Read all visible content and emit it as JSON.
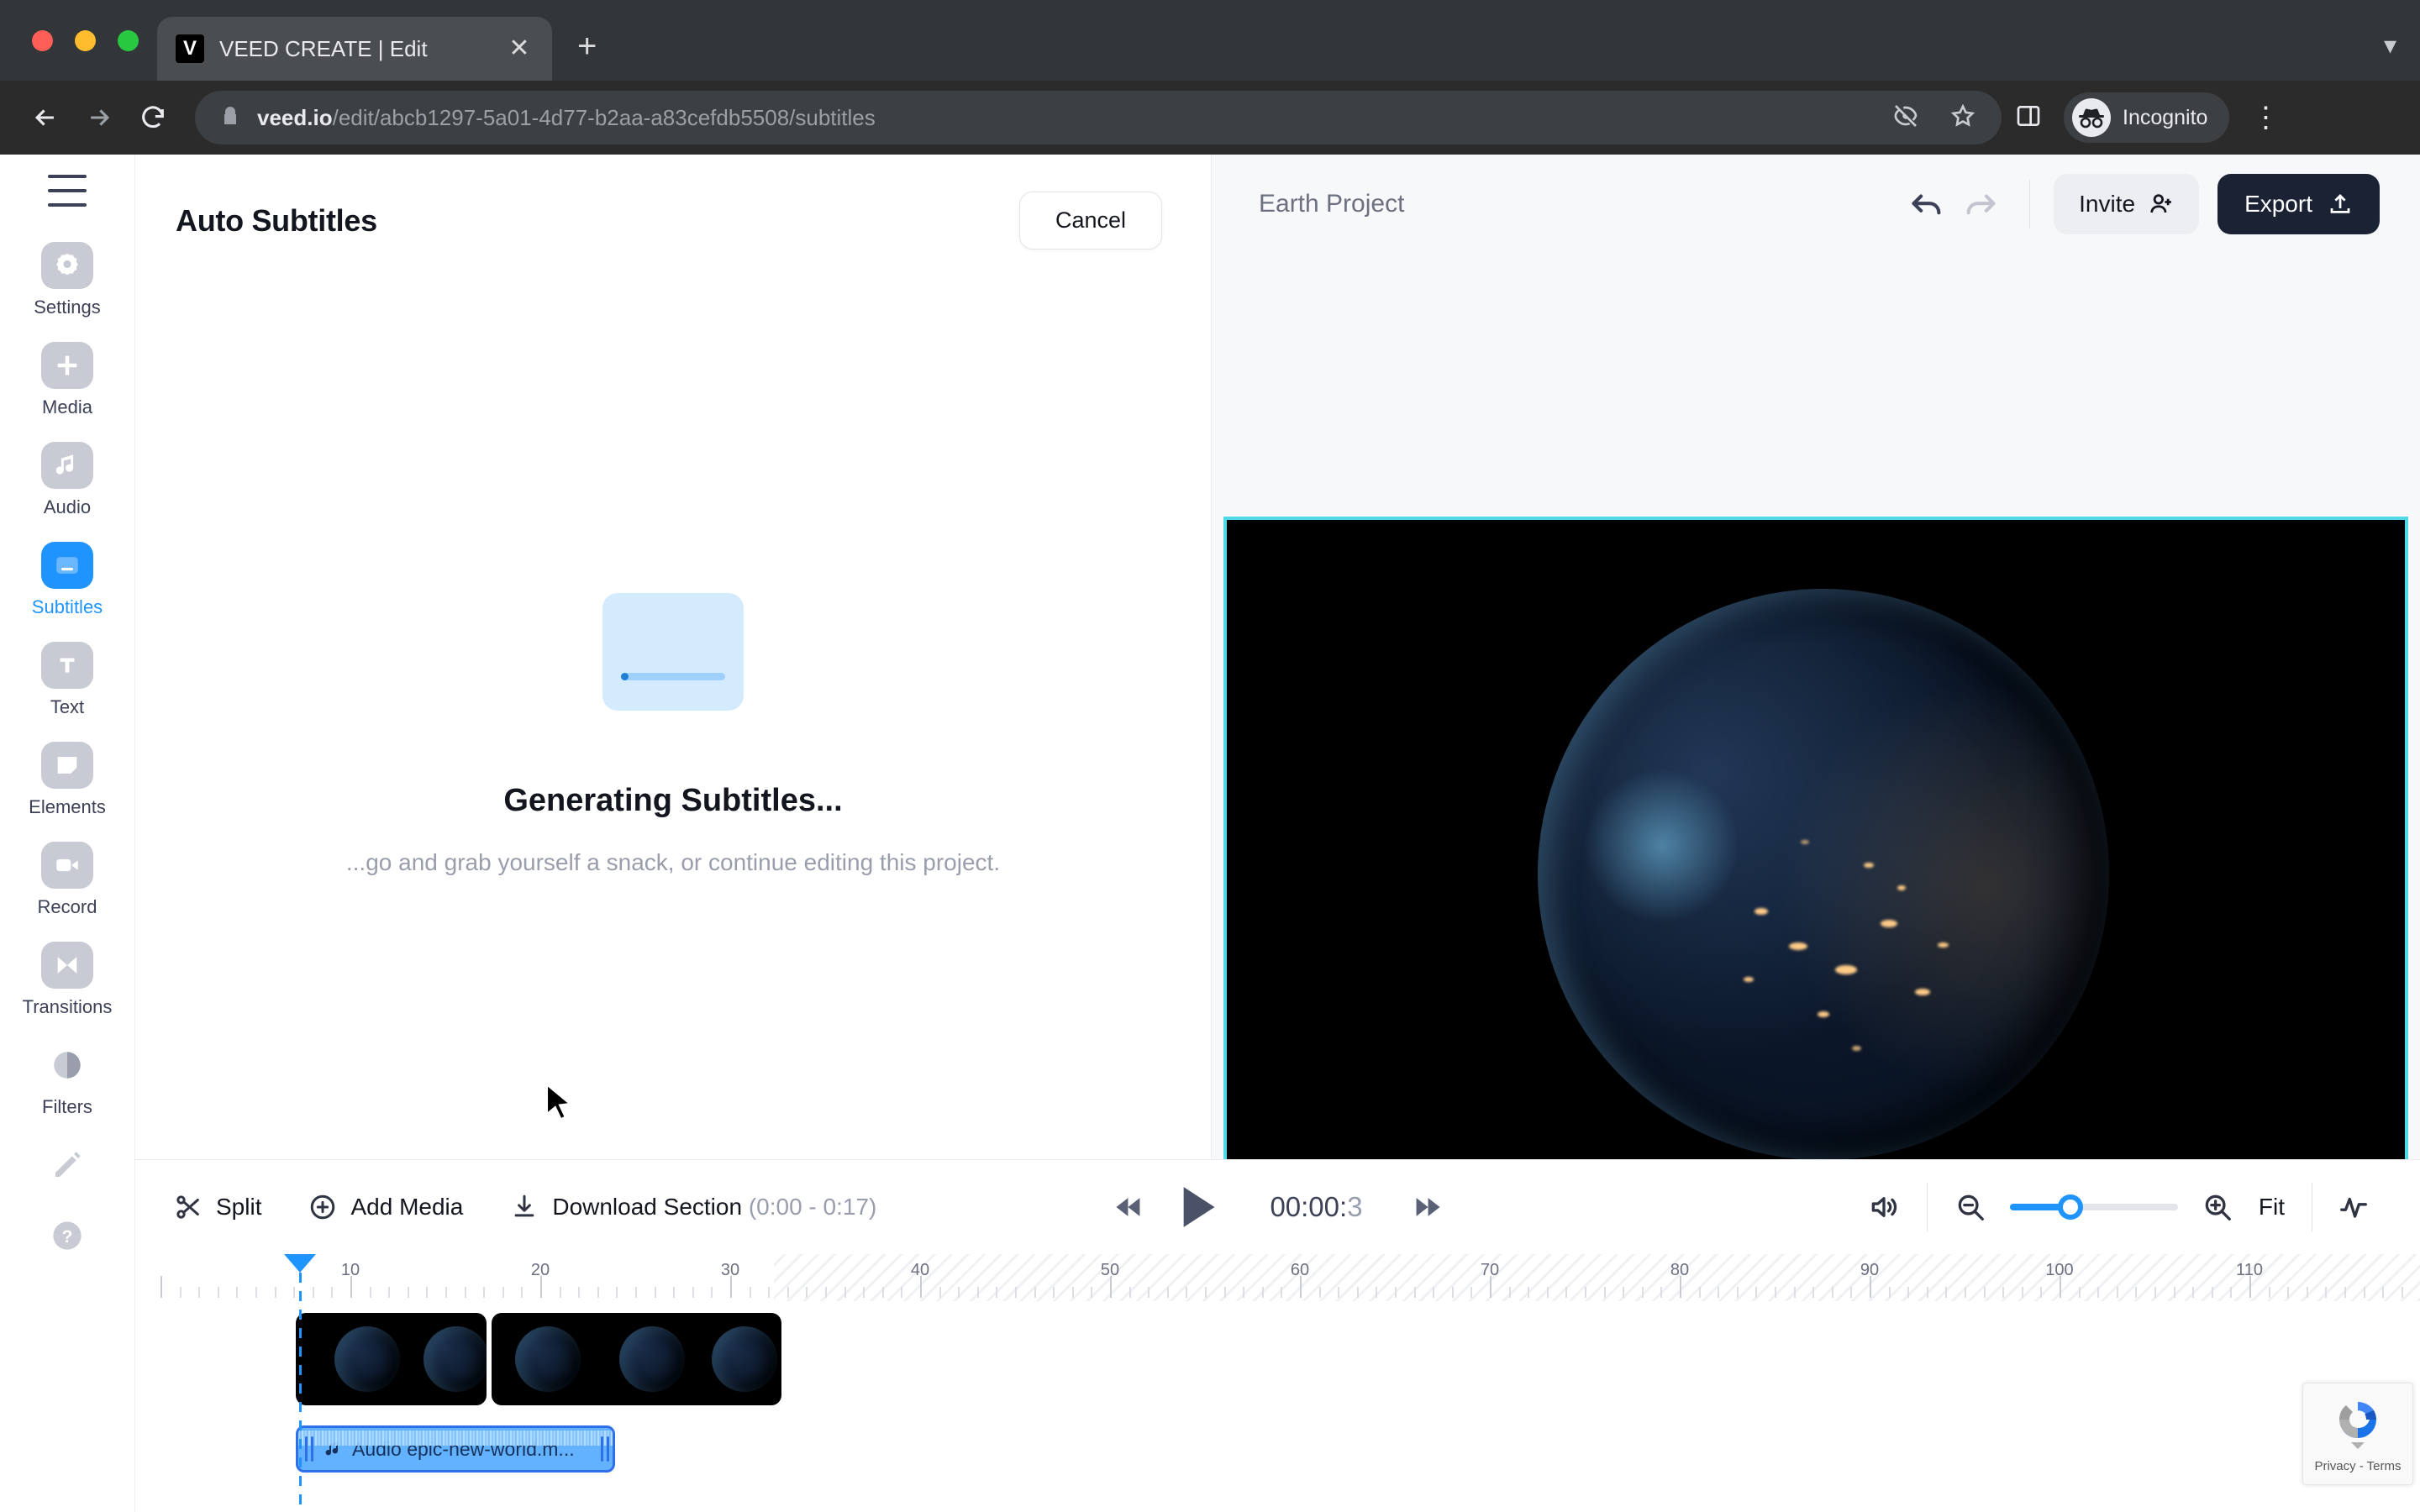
{
  "browser": {
    "tab": {
      "title": "VEED CREATE | Edit",
      "favicon_letter": "V",
      "close_icon": "close-icon"
    },
    "new_tab_label": "+",
    "url_host": "veed.io",
    "url_path": "/edit/abcb1297-5a01-4d77-b2aa-a83cefdb5508/subtitles",
    "profile_label": "Incognito",
    "icons": {
      "back": "back-arrow-icon",
      "forward": "forward-arrow-icon",
      "reload": "reload-icon",
      "lock": "lock-icon",
      "eye_off": "eye-off-icon",
      "bookmark": "star-icon",
      "side_panel": "side-panel-icon",
      "menu": "kebab-menu-icon"
    }
  },
  "sidebar": {
    "menu_icon": "hamburger-icon",
    "items": [
      {
        "label": "Settings",
        "icon": "gear-icon",
        "active": false
      },
      {
        "label": "Media",
        "icon": "plus-icon",
        "active": false
      },
      {
        "label": "Audio",
        "icon": "music-note-icon",
        "active": false
      },
      {
        "label": "Subtitles",
        "icon": "subtitles-icon",
        "active": true
      },
      {
        "label": "Text",
        "icon": "text-icon",
        "active": false
      },
      {
        "label": "Elements",
        "icon": "elements-icon",
        "active": false
      },
      {
        "label": "Record",
        "icon": "video-camera-icon",
        "active": false
      },
      {
        "label": "Transitions",
        "icon": "transitions-icon",
        "active": false
      },
      {
        "label": "Filters",
        "icon": "contrast-icon",
        "active": false
      }
    ],
    "footer_items": [
      {
        "label": "",
        "icon": "pencil-icon"
      },
      {
        "label": "",
        "icon": "help-icon"
      }
    ],
    "active_color": "#1f94ff"
  },
  "panel": {
    "title": "Auto Subtitles",
    "cancel_label": "Cancel",
    "loading_title": "Generating Subtitles...",
    "loading_subtitle": "...go and grab yourself a snack, or continue editing this project.",
    "loader_icon": "subtitle-card-loader-icon"
  },
  "stage": {
    "project_title": "Earth Project",
    "undo_icon": "undo-icon",
    "redo_icon": "redo-icon",
    "invite_label": "Invite",
    "invite_icon": "add-person-icon",
    "export_label": "Export",
    "export_icon": "upload-icon",
    "selection_color": "#4fd8e8",
    "canvas_background": "#000000"
  },
  "timeline": {
    "split_label": "Split",
    "split_icon": "scissors-icon",
    "add_media_label": "Add Media",
    "add_media_icon": "plus-circle-icon",
    "download_label": "Download Section",
    "download_range": "(0:00 - 0:17)",
    "download_icon": "download-icon",
    "skip_back_icon": "skip-back-icon",
    "play_icon": "play-icon",
    "skip_forward_icon": "skip-forward-icon",
    "timecode_main": "00:00:",
    "timecode_frac": "3",
    "volume_icon": "volume-icon",
    "zoom_out_icon": "zoom-out-icon",
    "zoom_in_icon": "zoom-in-icon",
    "zoom_value": 36,
    "fit_label": "Fit",
    "waveform_icon": "waveform-icon",
    "ruler_ticks": [
      10,
      20,
      30,
      40,
      50,
      60,
      70,
      80,
      90,
      100,
      110
    ],
    "playhead_position": 0,
    "video_clips": [
      {
        "name": "video-clip-1"
      },
      {
        "name": "video-clip-2"
      }
    ],
    "audio_clip": {
      "label": "Audio epic-new-world.m...",
      "icon": "music-note-icon",
      "selected": true,
      "color": "#63b2ff"
    }
  },
  "recaptcha": {
    "terms_label": "Privacy - Terms",
    "logo_icon": "recaptcha-logo-icon"
  },
  "cursor": {
    "icon": "mouse-pointer-icon"
  }
}
